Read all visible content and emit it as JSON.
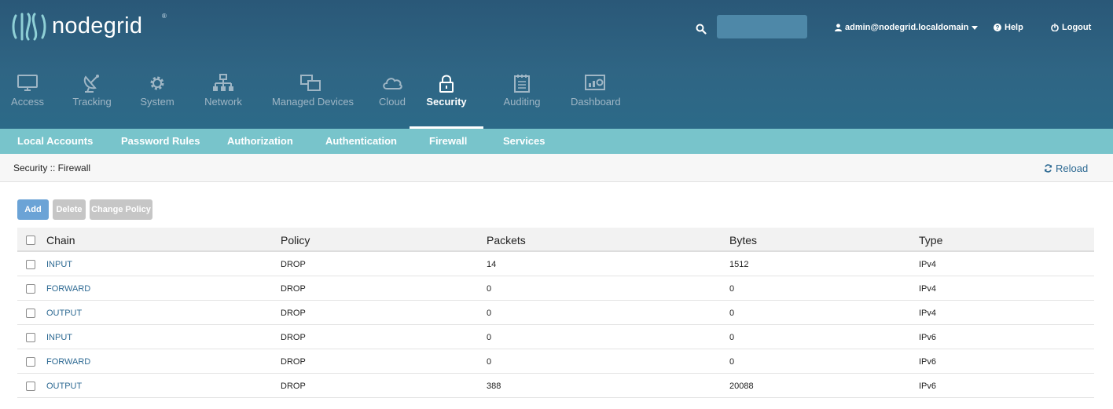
{
  "app": {
    "logo_text": "nodegrid",
    "logo_reg": "®"
  },
  "header": {
    "search": {
      "placeholder": "",
      "value": "",
      "icon": "search-icon"
    },
    "user": {
      "label": "admin@nodegrid.localdomain",
      "icon": "user-icon",
      "caret": "caret-down-icon"
    },
    "help": {
      "label": "Help",
      "icon": "question-circle-icon"
    },
    "logout": {
      "label": "Logout",
      "icon": "power-icon"
    }
  },
  "main_nav": [
    {
      "label": "Access",
      "icon": "monitor-icon",
      "active": false
    },
    {
      "label": "Tracking",
      "icon": "satellite-dish-icon",
      "active": false
    },
    {
      "label": "System",
      "icon": "gear-icon",
      "active": false
    },
    {
      "label": "Network",
      "icon": "network-icon",
      "active": false
    },
    {
      "label": "Managed Devices",
      "icon": "devices-icon",
      "active": false
    },
    {
      "label": "Cloud",
      "icon": "cloud-icon",
      "active": false
    },
    {
      "label": "Security",
      "icon": "lock-icon",
      "active": true
    },
    {
      "label": "Auditing",
      "icon": "notepad-icon",
      "active": false
    },
    {
      "label": "Dashboard",
      "icon": "dashboard-icon",
      "active": false
    }
  ],
  "sub_nav": [
    {
      "label": "Local Accounts",
      "active": false
    },
    {
      "label": "Password Rules",
      "active": false
    },
    {
      "label": "Authorization",
      "active": false
    },
    {
      "label": "Authentication",
      "active": false
    },
    {
      "label": "Firewall",
      "active": true
    },
    {
      "label": "Services",
      "active": false
    }
  ],
  "breadcrumb": "Security :: Firewall",
  "reload": {
    "label": "Reload",
    "icon": "refresh-icon"
  },
  "toolbar": {
    "add_label": "Add",
    "delete_label": "Delete",
    "change_policy_label": "Change Policy"
  },
  "table": {
    "columns": [
      "Chain",
      "Policy",
      "Packets",
      "Bytes",
      "Type"
    ],
    "rows": [
      {
        "chain": "INPUT",
        "policy": "DROP",
        "packets": "14",
        "bytes": "1512",
        "type": "IPv4"
      },
      {
        "chain": "FORWARD",
        "policy": "DROP",
        "packets": "0",
        "bytes": "0",
        "type": "IPv4"
      },
      {
        "chain": "OUTPUT",
        "policy": "DROP",
        "packets": "0",
        "bytes": "0",
        "type": "IPv4"
      },
      {
        "chain": "INPUT",
        "policy": "DROP",
        "packets": "0",
        "bytes": "0",
        "type": "IPv6"
      },
      {
        "chain": "FORWARD",
        "policy": "DROP",
        "packets": "0",
        "bytes": "0",
        "type": "IPv6"
      },
      {
        "chain": "OUTPUT",
        "policy": "DROP",
        "packets": "388",
        "bytes": "20088",
        "type": "IPv6"
      }
    ]
  },
  "colors": {
    "header_bg": "#2f6584",
    "subnav_bg": "#78c4cb",
    "link": "#2e6a93",
    "primary_button": "#6ba3d6",
    "disabled_button": "#c6c6c6"
  }
}
